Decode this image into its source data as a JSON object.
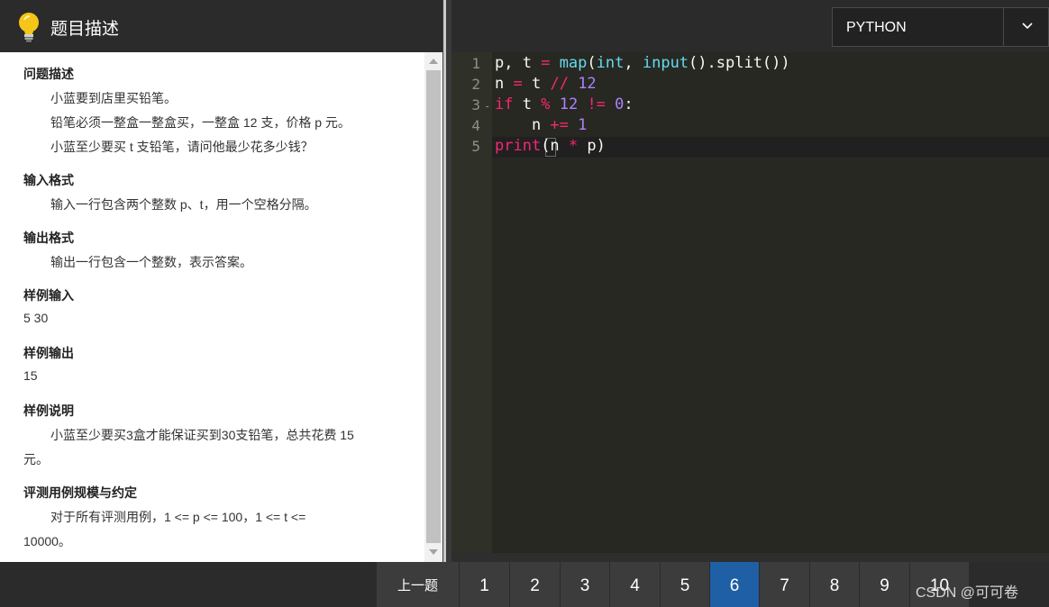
{
  "left": {
    "title": "题目描述",
    "sections": [
      {
        "title": "问题描述",
        "lines": [
          "小蓝要到店里买铅笔。",
          "铅笔必须一整盒一整盒买，一整盒 12 支，价格 p 元。",
          "小蓝至少要买 t 支铅笔，请问他最少花多少钱？"
        ]
      },
      {
        "title": "输入格式",
        "lines": [
          "输入一行包含两个整数 p、t，用一个空格分隔。"
        ]
      },
      {
        "title": "输出格式",
        "lines": [
          "输出一行包含一个整数，表示答案。"
        ]
      },
      {
        "title": "样例输入",
        "lines": [
          "5 30"
        ]
      },
      {
        "title": "样例输出",
        "lines": [
          "15"
        ]
      },
      {
        "title": "样例说明",
        "lines": [
          "小蓝至少要买3盒才能保证买到30支铅笔，总共花费 15",
          "元。"
        ]
      },
      {
        "title": "评测用例规模与约定",
        "lines": [
          "对于所有评测用例，1 <= p <= 100，1 <= t <=",
          "10000。"
        ]
      }
    ]
  },
  "editor": {
    "language": "PYTHON",
    "line_numbers": [
      "1",
      "2",
      "3",
      "4",
      "5"
    ],
    "fold_marker": "-",
    "code": {
      "l1": {
        "a": "p, t ",
        "b": "=",
        "c": " ",
        "d": "map",
        "e": "(",
        "f": "int",
        "g": ", ",
        "h": "input",
        "i": "().split())"
      },
      "l2": {
        "a": "n ",
        "b": "=",
        "c": " t ",
        "d": "//",
        "e": " ",
        "f": "12"
      },
      "l3": {
        "a": "if",
        "b": " t ",
        "c": "%",
        "d": " ",
        "e": "12",
        "f": " ",
        "g": "!=",
        "h": " ",
        "i": "0",
        "j": ":"
      },
      "l4": {
        "a": "    n ",
        "b": "+=",
        "c": " ",
        "d": "1"
      },
      "l5": {
        "a": "print",
        "b": "(n ",
        "c": "*",
        "d": " p)"
      }
    }
  },
  "pager": {
    "prev_label": "上一题",
    "pages": [
      "1",
      "2",
      "3",
      "4",
      "5",
      "6",
      "7",
      "8",
      "9",
      "10"
    ],
    "active_page": "6"
  },
  "watermark": "CSDN @可可卷"
}
